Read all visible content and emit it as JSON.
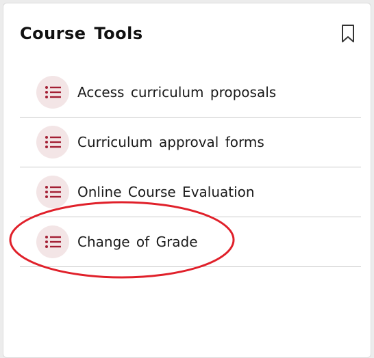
{
  "card": {
    "title": "Course Tools"
  },
  "items": [
    {
      "label": "Access curriculum proposals",
      "icon": "list-icon"
    },
    {
      "label": "Curriculum approval forms",
      "icon": "list-icon"
    },
    {
      "label": "Online Course Evaluation",
      "icon": "list-icon"
    },
    {
      "label": "Change of Grade",
      "icon": "list-icon"
    }
  ],
  "colors": {
    "accent": "#a31f34",
    "icon_bg": "#f3e5e6",
    "highlight_annotation": "#e0202a"
  }
}
